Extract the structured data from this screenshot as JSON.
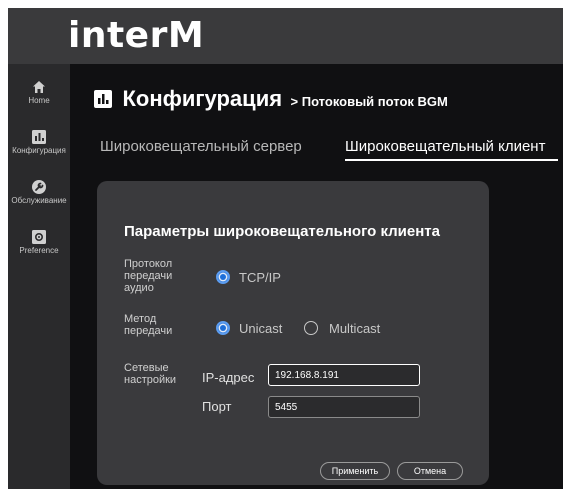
{
  "brand": {
    "logo": "interM"
  },
  "sidebar": {
    "items": [
      {
        "label": "Home",
        "icon": "home-icon"
      },
      {
        "label": "Конфигурация",
        "icon": "chart-icon"
      },
      {
        "label": "Обслуживание",
        "icon": "wrench-icon"
      },
      {
        "label": "Preference",
        "icon": "gear-icon"
      }
    ]
  },
  "header": {
    "title": "Конфигурация",
    "subtitle": "> Потоковый поток BGM"
  },
  "tabs": [
    {
      "label": "Широковещательный сервер",
      "active": false
    },
    {
      "label": "Широковещательный клиент",
      "active": true
    }
  ],
  "panel": {
    "title": "Параметры широковещательного клиента",
    "protocol": {
      "label": "Протокол передачи аудио",
      "options": [
        {
          "label": "TCP/IP",
          "selected": true
        }
      ]
    },
    "method": {
      "label": "Метод передачи",
      "options": [
        {
          "label": "Unicast",
          "selected": true
        },
        {
          "label": "Multicast",
          "selected": false
        }
      ]
    },
    "network": {
      "label": "Сетевые настройки",
      "ip_label": "IP-адрес",
      "ip_value": "192.168.8.191",
      "port_label": "Порт",
      "port_value": "5455"
    },
    "apply_label": "Применить",
    "cancel_label": "Отмена"
  },
  "colors": {
    "accent": "#1e6fd9",
    "panel_bg": "#3a3a3d",
    "page_bg": "#101012",
    "topbar_bg": "#3a3a3c"
  }
}
